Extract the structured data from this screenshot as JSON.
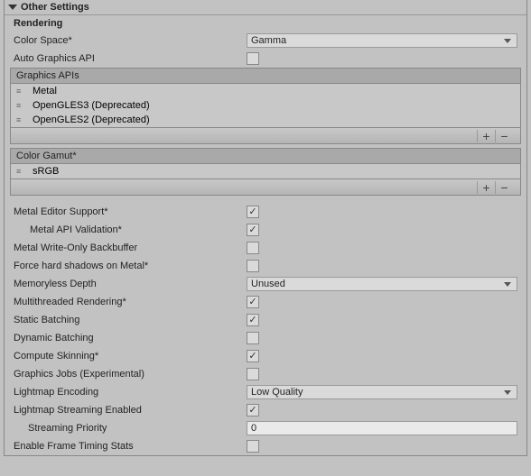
{
  "section_title": "Other Settings",
  "subsection_title": "Rendering",
  "color_space": {
    "label": "Color Space*",
    "value": "Gamma"
  },
  "auto_graphics_api": {
    "label": "Auto Graphics API",
    "checked": false
  },
  "graphics_apis": {
    "header": "Graphics APIs",
    "items": [
      "Metal",
      "OpenGLES3 (Deprecated)",
      "OpenGLES2 (Deprecated)"
    ]
  },
  "color_gamut": {
    "header": "Color Gamut*",
    "items": [
      "sRGB"
    ]
  },
  "metal_editor_support": {
    "label": "Metal Editor Support*",
    "checked": true
  },
  "metal_api_validation": {
    "label": "Metal API Validation*",
    "checked": true
  },
  "metal_write_only": {
    "label": "Metal Write-Only Backbuffer",
    "checked": false
  },
  "force_hard_shadows": {
    "label": "Force hard shadows on Metal*",
    "checked": false
  },
  "memoryless_depth": {
    "label": "Memoryless Depth",
    "value": "Unused"
  },
  "multithreaded_rendering": {
    "label": "Multithreaded Rendering*",
    "checked": true
  },
  "static_batching": {
    "label": "Static Batching",
    "checked": true
  },
  "dynamic_batching": {
    "label": "Dynamic Batching",
    "checked": false
  },
  "compute_skinning": {
    "label": "Compute Skinning*",
    "checked": true
  },
  "graphics_jobs": {
    "label": "Graphics Jobs (Experimental)",
    "checked": false
  },
  "lightmap_encoding": {
    "label": "Lightmap Encoding",
    "value": "Low Quality"
  },
  "lightmap_streaming": {
    "label": "Lightmap Streaming Enabled",
    "checked": true
  },
  "streaming_priority": {
    "label": "Streaming Priority",
    "value": "0"
  },
  "frame_timing": {
    "label": "Enable Frame Timing Stats",
    "checked": false
  }
}
